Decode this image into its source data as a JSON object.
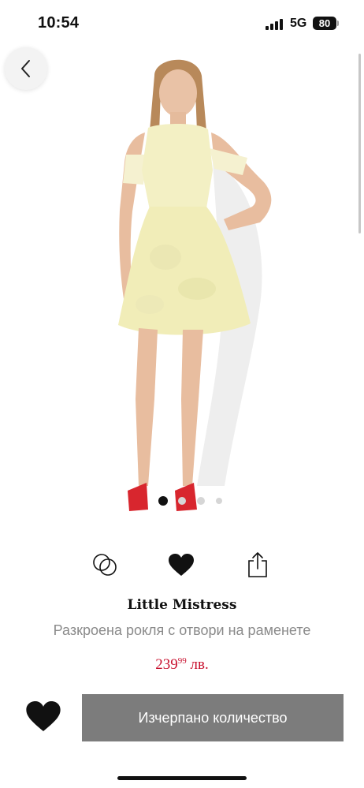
{
  "status_bar": {
    "time": "10:54",
    "network": "5G",
    "battery": "80"
  },
  "product": {
    "brand": "Little Mistress",
    "name": "Разкроена рокля с отвори на раменете",
    "price_main": "239",
    "price_cents": "99",
    "currency": "лв.",
    "image_description": "Model wearing pale yellow jacquard cold-shoulder skater dress with red heels"
  },
  "carousel": {
    "total": 4,
    "active": 1
  },
  "actions": {
    "compare_icon": "compare-rings-icon",
    "favorite_icon": "heart-icon",
    "share_icon": "share-icon"
  },
  "bottom_bar": {
    "soldout_label": "Изчерпано количество"
  },
  "colors": {
    "price": "#c8102e",
    "soldout_button": "#7c7c7c",
    "dress": "#f3f0c4"
  }
}
